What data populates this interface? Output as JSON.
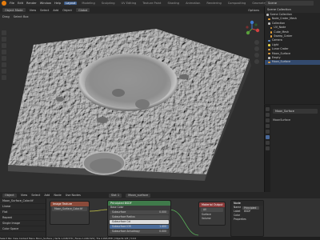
{
  "topbar": {
    "menus": [
      "File",
      "Edit",
      "Render",
      "Window",
      "Help"
    ],
    "workspaces": [
      "Layout",
      "Modeling",
      "Sculpting",
      "UV Editing",
      "Texture Paint",
      "Shading",
      "Animation",
      "Rendering",
      "Compositing",
      "Geometry Nodes",
      "Scripting"
    ],
    "active_workspace": "Layout",
    "scene": "Scene",
    "view_layer": "ViewLayer"
  },
  "viewport": {
    "mode": "Object Mode",
    "menus": [
      "View",
      "Select",
      "Add",
      "Object"
    ],
    "orientation": "Global",
    "header2": [
      "Drag",
      "Select Box"
    ],
    "options_label": "Options"
  },
  "outliner": {
    "title": "Scene Collection",
    "rows": [
      {
        "label": "Scene Collection",
        "color": "#bdbdbd",
        "indent": 0
      },
      {
        "label": "Node_Crater_Mesh",
        "color": "#e8a23c",
        "indent": 2
      },
      {
        "label": "Collection",
        "color": "#bdbdbd",
        "indent": 2
      },
      {
        "label": "UV_Node",
        "color": "#e8a23c",
        "indent": 4
      },
      {
        "label": "Cube_Mesh",
        "color": "#e8a23c",
        "indent": 4
      },
      {
        "label": "Sweep_Crater",
        "color": "#e8a23c",
        "indent": 4
      },
      {
        "label": "Camera",
        "color": "#5a8ed6",
        "indent": 2
      },
      {
        "label": "Light",
        "color": "#e6d34a",
        "indent": 2
      },
      {
        "label": "Lunar Crater",
        "color": "#e8a23c",
        "indent": 2
      },
      {
        "label": "Moon_Surface",
        "color": "#e8a23c",
        "indent": 2
      },
      {
        "label": "Empty",
        "color": "#bdbdbd",
        "indent": 2
      },
      {
        "label": "Moon_Surface",
        "color": "#e8a23c",
        "indent": 2,
        "selected": true
      }
    ]
  },
  "properties": {
    "object_name": "Moon_Surface",
    "sub_label": "MoonSurface"
  },
  "node_editor": {
    "header": [
      "Object",
      "View",
      "Select",
      "Add",
      "Node",
      "Use Nodes"
    ],
    "slot": "Slot 1",
    "material": "Moon_surface",
    "left_rows": [
      "Moon_Surface_Color.tif",
      "Linear",
      "Flat",
      "Repeat",
      "Single Image",
      "Color Space",
      "Alpha"
    ],
    "tex_node": {
      "title": "Image Texture",
      "file": "Moon_Surface_Color.tif"
    },
    "bsdf": {
      "title": "Principled BSDF",
      "rows": [
        {
          "label": "Base Color",
          "value": ""
        },
        {
          "label": "Subsurface",
          "value": "0.000"
        },
        {
          "label": "Subsurface Radius",
          "value": ""
        },
        {
          "label": "Subsurface Col",
          "value": ""
        },
        {
          "label": "Subsurface IOR",
          "value": "1.400"
        },
        {
          "label": "Subsurface Anisotropy",
          "value": "0.000"
        },
        {
          "label": "Metallic",
          "value": "0.000"
        }
      ]
    },
    "output": {
      "title": "Material Output",
      "target": "All",
      "rows": [
        "Surface",
        "Volume",
        "Displacement"
      ]
    },
    "nprops": {
      "title": "Node",
      "name_label": "Name",
      "name_value": "Principled BSDF",
      "label_label": "Label",
      "rows": [
        "Color",
        "Properties"
      ]
    }
  },
  "status": {
    "text": "Select   Pan View   Context Menu   Moon_Surface | Verts 1,048,576 | Faces 1,046,529 | Tris 2,093,058 | Objects 1/8 | 3.0.0"
  },
  "colors": {
    "accent": "#e87d0d",
    "selected": "#334a6e"
  }
}
